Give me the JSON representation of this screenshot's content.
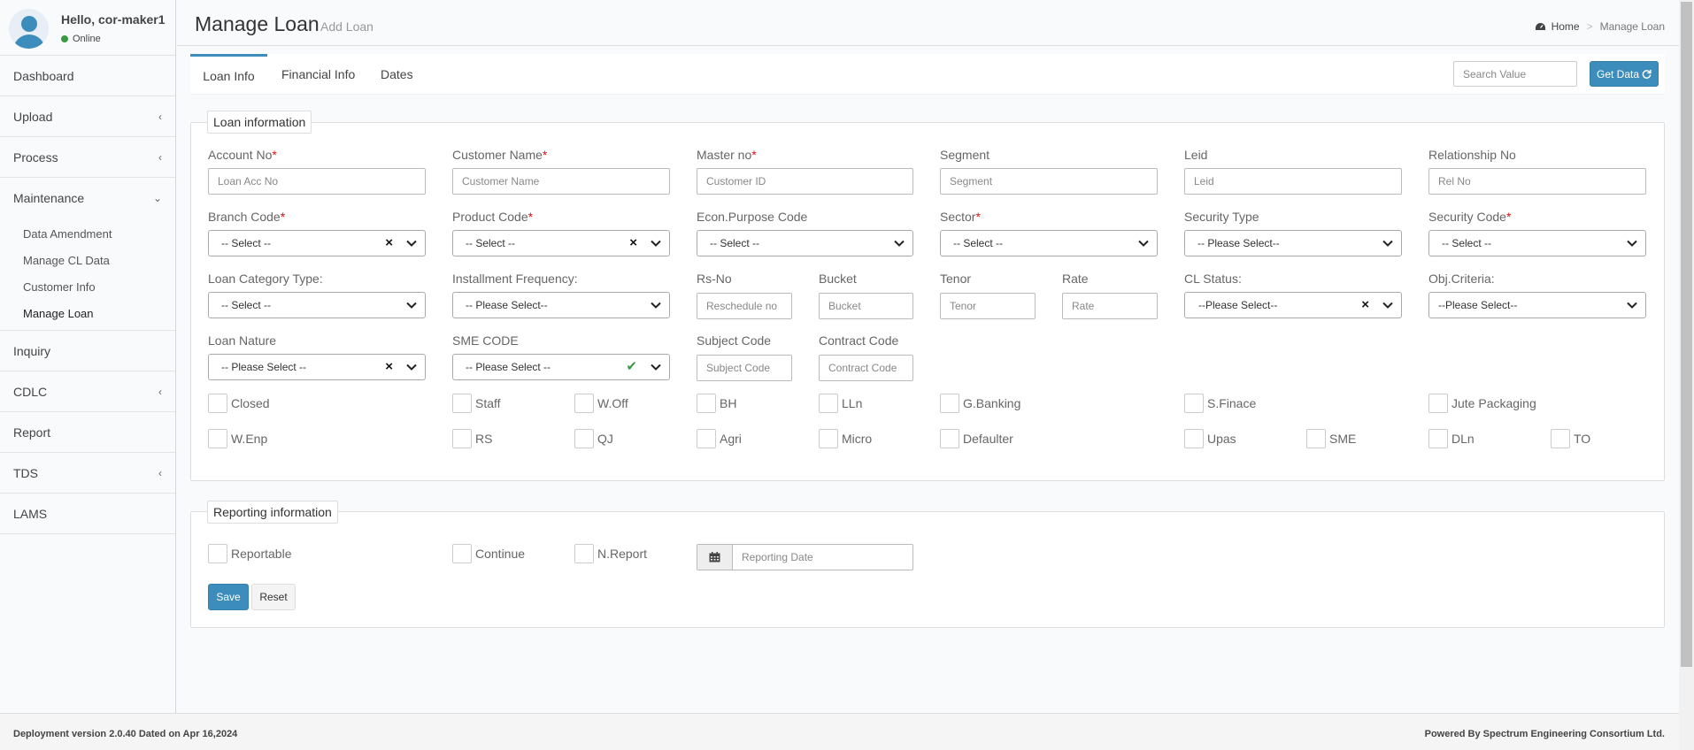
{
  "user": {
    "greeting": "Hello, cor-maker1",
    "status": "Online"
  },
  "sidebar": {
    "items": [
      {
        "label": "Dashboard",
        "chevron": ""
      },
      {
        "label": "Upload",
        "chevron": "‹"
      },
      {
        "label": "Process",
        "chevron": "‹"
      },
      {
        "label": "Maintenance",
        "chevron": "⌄"
      },
      {
        "label": "Inquiry",
        "chevron": ""
      },
      {
        "label": "CDLC",
        "chevron": "‹"
      },
      {
        "label": "Report",
        "chevron": ""
      },
      {
        "label": "TDS",
        "chevron": "‹"
      },
      {
        "label": "LAMS",
        "chevron": ""
      }
    ],
    "maintenance_sub": [
      "Data Amendment",
      "Manage CL Data",
      "Customer Info",
      "Manage Loan"
    ]
  },
  "header": {
    "title": "Manage Loan",
    "subtitle": "Add Loan",
    "breadcrumb_home": "Home",
    "breadcrumb_sep": ">",
    "breadcrumb_current": "Manage Loan"
  },
  "tabs": [
    "Loan Info",
    "Financial Info",
    "Dates"
  ],
  "search": {
    "placeholder": "Search Value",
    "button": "Get Data"
  },
  "loan_info": {
    "legend": "Loan information",
    "account_no": {
      "label": "Account No",
      "placeholder": "Loan Acc No"
    },
    "customer_name": {
      "label": "Customer Name",
      "placeholder": "Customer Name"
    },
    "master_no": {
      "label": "Master no",
      "placeholder": "Customer ID"
    },
    "segment": {
      "label": "Segment",
      "placeholder": "Segment"
    },
    "leid": {
      "label": "Leid",
      "placeholder": "Leid"
    },
    "relationship_no": {
      "label": "Relationship No",
      "placeholder": "Rel No"
    },
    "branch_code": {
      "label": "Branch Code",
      "value": "-- Select --"
    },
    "product_code": {
      "label": "Product Code",
      "value": "-- Select --"
    },
    "econ_purpose_code": {
      "label": "Econ.Purpose Code",
      "value": "-- Select --"
    },
    "sector": {
      "label": "Sector",
      "value": "-- Select --"
    },
    "security_type": {
      "label": "Security Type",
      "value": "-- Please Select--"
    },
    "security_code": {
      "label": "Security Code",
      "value": "-- Select --"
    },
    "loan_category_type": {
      "label": "Loan Category Type:",
      "value": "-- Select --"
    },
    "installment_frequency": {
      "label": "Installment Frequency:",
      "value": "-- Please Select--"
    },
    "rs_no": {
      "label": "Rs-No",
      "placeholder": "Reschedule no"
    },
    "bucket": {
      "label": "Bucket",
      "placeholder": "Bucket"
    },
    "tenor": {
      "label": "Tenor",
      "placeholder": "Tenor"
    },
    "rate": {
      "label": "Rate",
      "placeholder": "Rate"
    },
    "cl_status": {
      "label": "CL Status:",
      "value": "--Please Select--"
    },
    "obj_criteria": {
      "label": "Obj.Criteria:",
      "value": "--Please Select--"
    },
    "loan_nature": {
      "label": "Loan Nature",
      "value": "-- Please Select --"
    },
    "sme_code": {
      "label": "SME CODE",
      "value": "-- Please Select --"
    },
    "subject_code": {
      "label": "Subject Code",
      "placeholder": "Subject Code"
    },
    "contract_code": {
      "label": "Contract Code",
      "placeholder": "Contract Code"
    },
    "checkboxes_row1": [
      "Closed",
      "Staff",
      "W.Off",
      "BH",
      "LLn",
      "G.Banking",
      "S.Finace",
      "Jute Packaging"
    ],
    "checkboxes_row2": [
      "W.Enp",
      "RS",
      "QJ",
      "Agri",
      "Micro",
      "Defaulter",
      "Upas",
      "SME",
      "DLn",
      "TO"
    ]
  },
  "reporting_info": {
    "legend": "Reporting information",
    "checkboxes": [
      "Reportable",
      "Continue",
      "N.Report"
    ],
    "reporting_date_placeholder": "Reporting Date",
    "save": "Save",
    "reset": "Reset"
  },
  "footer": {
    "left": "Deployment version 2.0.40 Dated on Apr 16,2024",
    "right": "Powered By Spectrum Engineering Consortium Ltd."
  },
  "colors": {
    "primary": "#3c8dbc",
    "required": "#dd1111",
    "online": "#3a9a44"
  },
  "required_mark": "*",
  "icons": {
    "clear": "×",
    "ok": "✔",
    "breadcrumb_home": "dashboard-icon",
    "calendar": "calendar-icon",
    "refresh": "refresh-icon"
  }
}
